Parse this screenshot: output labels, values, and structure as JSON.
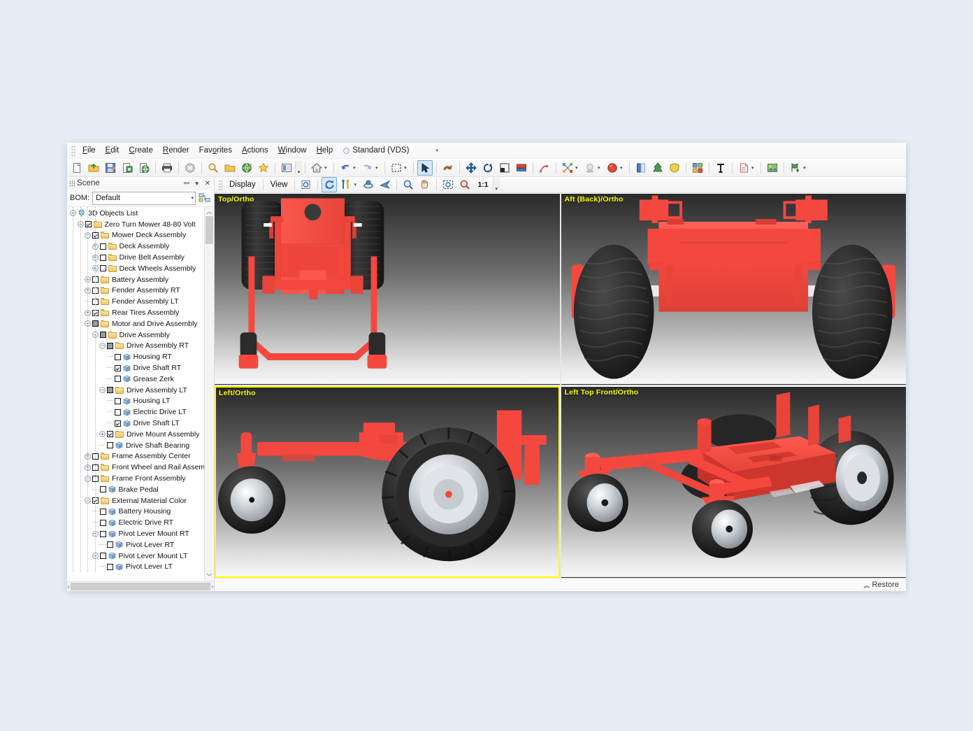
{
  "menubar": {
    "items": [
      {
        "label": "File",
        "accel": "F"
      },
      {
        "label": "Edit",
        "accel": "E"
      },
      {
        "label": "Create",
        "accel": "C"
      },
      {
        "label": "Render",
        "accel": "R"
      },
      {
        "label": "Favorites",
        "accel": "o"
      },
      {
        "label": "Actions",
        "accel": "A"
      },
      {
        "label": "Window",
        "accel": "W"
      },
      {
        "label": "Help",
        "accel": "H"
      }
    ],
    "profile": "Standard (VDS)",
    "profile_caret": "▾"
  },
  "toolbar": {
    "groups": [
      {
        "buttons": [
          {
            "name": "new-document-icon",
            "glyph": "doc"
          },
          {
            "name": "open-folder-icon",
            "glyph": "open"
          },
          {
            "name": "save-icon",
            "glyph": "save"
          },
          {
            "name": "export-icon",
            "glyph": "export"
          },
          {
            "name": "publish-web-icon",
            "glyph": "globe"
          }
        ]
      },
      {
        "buttons": [
          {
            "name": "print-icon",
            "glyph": "print"
          }
        ]
      },
      {
        "buttons": [
          {
            "name": "cancel-icon",
            "glyph": "cancel"
          }
        ]
      },
      {
        "buttons": [
          {
            "name": "search-icon",
            "glyph": "magnify"
          },
          {
            "name": "browse-folder-icon",
            "glyph": "openfolder"
          },
          {
            "name": "internet-icon",
            "glyph": "globe2"
          },
          {
            "name": "favorites-star-icon",
            "glyph": "star"
          }
        ]
      },
      {
        "buttons": [
          {
            "name": "panel-toggle-icon",
            "glyph": "panel"
          }
        ]
      },
      {
        "buttons": [
          {
            "name": "home-view-icon",
            "glyph": "home"
          }
        ],
        "caret": true
      },
      {
        "buttons": [
          {
            "name": "undo-icon",
            "glyph": "undo"
          },
          {
            "name": "redo-icon",
            "glyph": "redo"
          }
        ],
        "carets": true
      },
      {
        "buttons": [
          {
            "name": "marquee-select-icon",
            "glyph": "marquee"
          }
        ],
        "caret": true
      },
      {
        "buttons": [
          {
            "name": "arrow-select-icon",
            "glyph": "arrow",
            "active": true
          }
        ]
      },
      {
        "buttons": [
          {
            "name": "pan-object-icon",
            "glyph": "panobj"
          }
        ]
      },
      {
        "buttons": [
          {
            "name": "move-icon",
            "glyph": "move"
          },
          {
            "name": "rotate-icon",
            "glyph": "rotate"
          },
          {
            "name": "scale-icon",
            "glyph": "scale"
          },
          {
            "name": "align-icon",
            "glyph": "align"
          }
        ]
      },
      {
        "buttons": [
          {
            "name": "path-animation-icon",
            "glyph": "path"
          }
        ]
      },
      {
        "buttons": [
          {
            "name": "explode-icon",
            "glyph": "explode"
          },
          {
            "name": "shadow-icon",
            "glyph": "shadow"
          },
          {
            "name": "material-ball-icon",
            "glyph": "ball"
          }
        ],
        "carets": true
      },
      {
        "buttons": [
          {
            "name": "book-icon",
            "glyph": "book"
          },
          {
            "name": "leaf-icon",
            "glyph": "leaf"
          },
          {
            "name": "shield-icon",
            "glyph": "shield"
          }
        ]
      },
      {
        "buttons": [
          {
            "name": "grid-layout-icon",
            "glyph": "grid"
          }
        ]
      },
      {
        "buttons": [
          {
            "name": "text-tool-icon",
            "glyph": "text"
          }
        ]
      },
      {
        "buttons": [
          {
            "name": "note-icon",
            "glyph": "note"
          }
        ],
        "caret": true
      },
      {
        "buttons": [
          {
            "name": "image-icon",
            "glyph": "image"
          }
        ]
      },
      {
        "buttons": [
          {
            "name": "marker-icon",
            "glyph": "marker"
          }
        ],
        "caret": true
      }
    ]
  },
  "scene_panel": {
    "title": "Scene",
    "header_icons": [
      {
        "name": "find-binoculars-icon",
        "glyph": "🔍"
      },
      {
        "name": "panel-menu-chevron-icon",
        "glyph": "▼"
      },
      {
        "name": "close-panel-icon",
        "glyph": "✕"
      }
    ],
    "bom_label": "BOM:",
    "bom_value": "Default",
    "bom_caret": "▾",
    "tree_tool_name": "tree-options-icon",
    "tree": [
      {
        "label": "3D Objects List",
        "depth": 0,
        "icon": "globe",
        "expander": "minus",
        "check": "none"
      },
      {
        "label": "Zero Turn Mower 48-80 Volt",
        "depth": 1,
        "icon": "folder",
        "expander": "minus",
        "check": "checked"
      },
      {
        "label": "Mower Deck Assembly",
        "depth": 2,
        "icon": "folder",
        "expander": "minus",
        "check": "checked"
      },
      {
        "label": "Deck Assembly",
        "depth": 3,
        "icon": "folder",
        "expander": "plus",
        "check": "unchecked"
      },
      {
        "label": "Drive Belt Assembly",
        "depth": 3,
        "icon": "folder",
        "expander": "plus",
        "check": "unchecked"
      },
      {
        "label": "Deck Wheels Assembly",
        "depth": 3,
        "icon": "folder",
        "expander": "plus",
        "check": "unchecked"
      },
      {
        "label": "Battery Assembly",
        "depth": 2,
        "icon": "folder",
        "expander": "plus",
        "check": "unchecked"
      },
      {
        "label": "Fender Assembly RT",
        "depth": 2,
        "icon": "folder",
        "expander": "plus",
        "check": "unchecked"
      },
      {
        "label": "Fender Assembly LT",
        "depth": 2,
        "icon": "folder",
        "expander": "none",
        "check": "unchecked"
      },
      {
        "label": "Rear Tires Assembly",
        "depth": 2,
        "icon": "folder",
        "expander": "plus",
        "check": "checked"
      },
      {
        "label": "Motor and Drive Assembly",
        "depth": 2,
        "icon": "folder",
        "expander": "minus",
        "check": "partial"
      },
      {
        "label": "Drive Assembly",
        "depth": 3,
        "icon": "folder",
        "expander": "minus",
        "check": "partial"
      },
      {
        "label": "Drive Assembly RT",
        "depth": 4,
        "icon": "folder",
        "expander": "minus",
        "check": "partial"
      },
      {
        "label": "Housing RT",
        "depth": 5,
        "icon": "cube",
        "expander": "none",
        "check": "unchecked"
      },
      {
        "label": "Drive Shaft RT",
        "depth": 5,
        "icon": "cube",
        "expander": "none",
        "check": "checked"
      },
      {
        "label": "Grease Zerk",
        "depth": 5,
        "icon": "cube",
        "expander": "none",
        "check": "unchecked"
      },
      {
        "label": "Drive Assembly LT",
        "depth": 4,
        "icon": "folder",
        "expander": "minus",
        "check": "partial"
      },
      {
        "label": "Housing LT",
        "depth": 5,
        "icon": "cube",
        "expander": "none",
        "check": "unchecked"
      },
      {
        "label": "Electric Drive LT",
        "depth": 5,
        "icon": "cube",
        "expander": "none",
        "check": "unchecked"
      },
      {
        "label": "Drive Shaft LT",
        "depth": 5,
        "icon": "cube",
        "expander": "none",
        "check": "checked"
      },
      {
        "label": "Drive Mount Assembly",
        "depth": 4,
        "icon": "folder",
        "expander": "plus",
        "check": "checked"
      },
      {
        "label": "Drive Shaft Bearing",
        "depth": 4,
        "icon": "cube",
        "expander": "none",
        "check": "unchecked"
      },
      {
        "label": "Frame Assembly Center",
        "depth": 2,
        "icon": "folder",
        "expander": "plus",
        "check": "unchecked"
      },
      {
        "label": "Front Wheel and Rail Assembly",
        "depth": 2,
        "icon": "folder",
        "expander": "plus",
        "check": "unchecked"
      },
      {
        "label": "Frame Front Assembly",
        "depth": 2,
        "icon": "folder",
        "expander": "minus",
        "check": "unchecked"
      },
      {
        "label": "Brake Pedal",
        "depth": 3,
        "icon": "cube",
        "expander": "none",
        "check": "unchecked"
      },
      {
        "label": "External Material Color",
        "depth": 2,
        "icon": "folder",
        "expander": "minus",
        "check": "checked"
      },
      {
        "label": "Battery Housing",
        "depth": 3,
        "icon": "cube",
        "expander": "none",
        "check": "unchecked"
      },
      {
        "label": "Electric Drive RT",
        "depth": 3,
        "icon": "cube",
        "expander": "none",
        "check": "unchecked"
      },
      {
        "label": "Pivot Lever Mount RT",
        "depth": 3,
        "icon": "cube",
        "expander": "minus",
        "check": "unchecked"
      },
      {
        "label": "Pivot Lever RT",
        "depth": 4,
        "icon": "cube",
        "expander": "none",
        "check": "unchecked"
      },
      {
        "label": "Pivot Lever Mount LT",
        "depth": 3,
        "icon": "cube",
        "expander": "minus",
        "check": "unchecked"
      },
      {
        "label": "Pivot Lever LT",
        "depth": 4,
        "icon": "cube",
        "expander": "none",
        "check": "unchecked"
      }
    ],
    "scroll_up_arrow": "︿",
    "scroll_down_arrow": "﹀",
    "scroll_left_arrow": "‹",
    "scroll_right_arrow": "›"
  },
  "viewport_toolbar": {
    "display_label": "Display",
    "view_label": "View",
    "zoom_ratio": "1:1",
    "buttons": [
      {
        "name": "snapshot-icon",
        "glyph": "snap"
      },
      {
        "name": "rotate-view-icon",
        "glyph": "rotview",
        "active": true
      },
      {
        "name": "walk-mode-icon",
        "glyph": "walk"
      },
      {
        "name": "turntable-icon",
        "glyph": "turn"
      },
      {
        "name": "fly-mode-icon",
        "glyph": "fly"
      },
      {
        "name": "zoom-in-icon",
        "glyph": "zoomin"
      },
      {
        "name": "pan-hand-icon",
        "glyph": "hand"
      },
      {
        "name": "zoom-window-icon",
        "glyph": "zoomwin"
      },
      {
        "name": "zoom-fit-icon",
        "glyph": "zoomfit"
      }
    ]
  },
  "viewports": [
    {
      "label": "Top/Ortho",
      "active": false,
      "view": "top"
    },
    {
      "label": "Aft (Back)/Ortho",
      "active": false,
      "view": "aft"
    },
    {
      "label": "Left/Ortho",
      "active": true,
      "view": "left"
    },
    {
      "label": "Left Top Front/Ortho",
      "active": false,
      "view": "iso"
    }
  ],
  "statusbar": {
    "restore_label": "Restore",
    "restore_icon": "︽"
  },
  "colors": {
    "model_red": "#f4483f",
    "model_red_light": "#ff6b60",
    "model_red_dark": "#c8362f",
    "tire_black": "#2e2e2e",
    "rim_silver": "#c9cdd2",
    "label_yellow": "#ffff00",
    "active_border": "#ffff00"
  }
}
